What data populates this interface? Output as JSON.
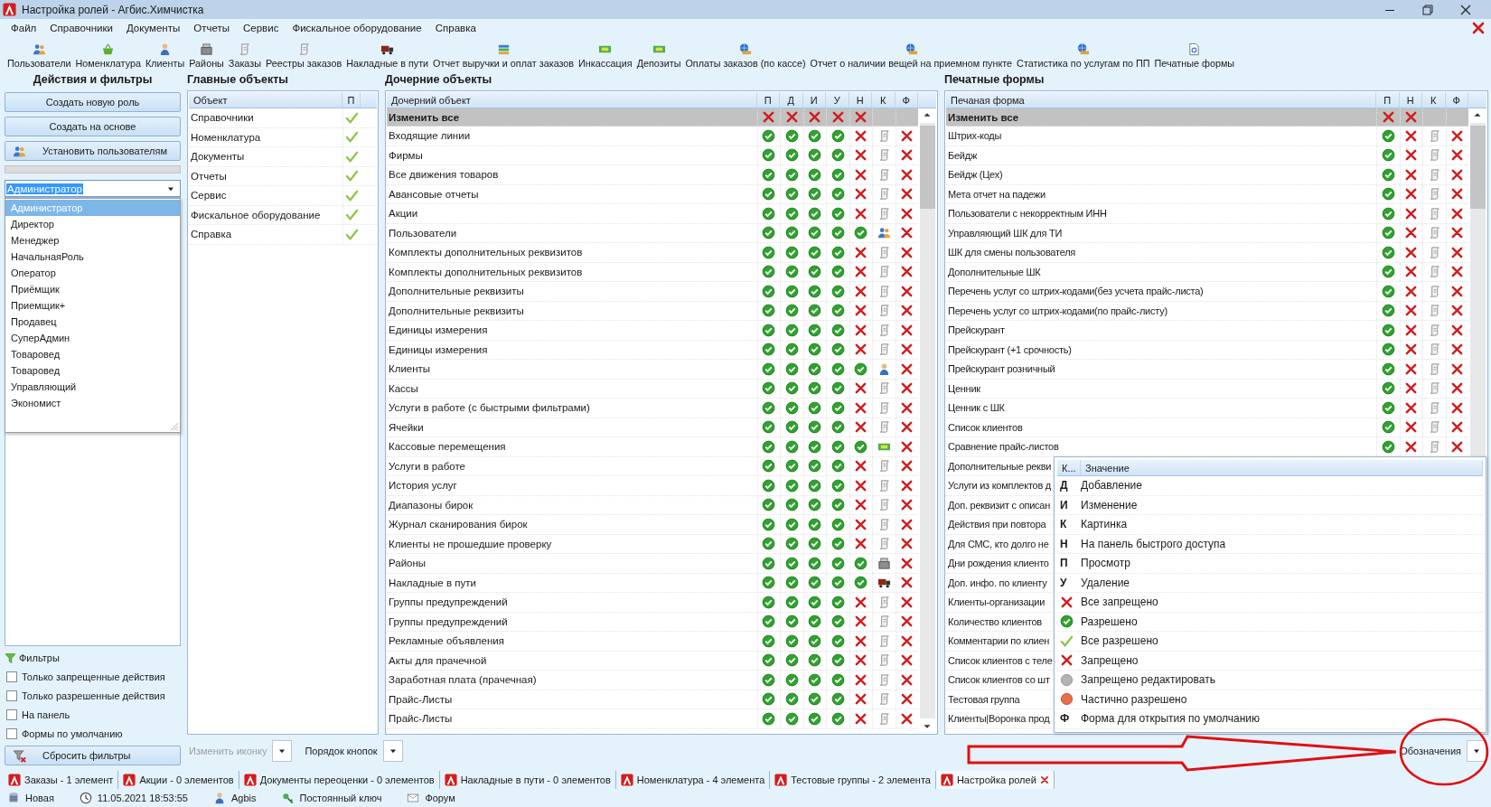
{
  "window": {
    "title": "Настройка ролей - Агбис.Химчистка"
  },
  "menu": [
    "Файл",
    "Справочники",
    "Документы",
    "Отчеты",
    "Сервис",
    "Фискальное оборудование",
    "Справка"
  ],
  "toolbar": [
    "Пользователи",
    "Номенклатура",
    "Клиенты",
    "Районы",
    "Заказы",
    "Реестры заказов",
    "Накладные в пути",
    "Отчет выручки и оплат заказов",
    "Инкассация",
    "Депозиты",
    "Оплаты заказов (по кассе)",
    "Отчет о наличии вещей на приемном пункте",
    "Статистика по услугам по ПП",
    "Печатные формы"
  ],
  "left_panel": {
    "title": "Действия и фильтры",
    "buttons": [
      "Создать новую роль",
      "Создать на основе",
      "Установить пользователям"
    ],
    "role_select": {
      "value": "Администратор",
      "options": [
        {
          "label": "Администратор",
          "selected": true
        },
        {
          "label": "Директор",
          "selected": false
        },
        {
          "label": "Менеджер",
          "selected": false
        },
        {
          "label": "НачальнаяРоль",
          "selected": false
        },
        {
          "label": "Оператор",
          "selected": false
        },
        {
          "label": "Приёмщик",
          "selected": false
        },
        {
          "label": "Приемщик+",
          "selected": false
        },
        {
          "label": "Продавец",
          "selected": false
        },
        {
          "label": "СуперАдмин",
          "selected": false
        },
        {
          "label": "Товаровед",
          "selected": false
        },
        {
          "label": "Товаровед",
          "selected": false
        },
        {
          "label": "Управляющий",
          "selected": false
        },
        {
          "label": "Экономист",
          "selected": false
        }
      ]
    },
    "filters_title": "Фильтры",
    "filters": [
      {
        "label": "Только запрещенные действия",
        "checked": false
      },
      {
        "label": "Только разрешенные действия",
        "checked": false
      },
      {
        "label": "На панель",
        "checked": false
      },
      {
        "label": "Формы по умолчанию",
        "checked": false
      }
    ],
    "reset_button": "Сбросить фильтры"
  },
  "main_objects": {
    "title": "Главные объекты",
    "columns": [
      "Объект",
      "П"
    ],
    "rows": [
      {
        "name": "Справочники",
        "view": true
      },
      {
        "name": "Номенклатура",
        "view": true
      },
      {
        "name": "Документы",
        "view": true
      },
      {
        "name": "Отчеты",
        "view": true
      },
      {
        "name": "Сервис",
        "view": true
      },
      {
        "name": "Фискальное оборудование",
        "view": true
      },
      {
        "name": "Справка",
        "view": true
      }
    ]
  },
  "child_objects": {
    "title": "Дочерние объекты",
    "columns": [
      "Дочерний объект",
      "П",
      "Д",
      "И",
      "У",
      "Н",
      "К",
      "Ф"
    ],
    "change_all": {
      "label": "Изменить все",
      "view": false,
      "add": false,
      "edit": false,
      "delete": false,
      "panel": false
    },
    "rows": [
      {
        "name": "Входящие линии",
        "view": true,
        "add": true,
        "edit": true,
        "delete": true,
        "panel": false,
        "kind": "scroll",
        "default_form": false
      },
      {
        "name": "Фирмы",
        "view": true,
        "add": true,
        "edit": true,
        "delete": true,
        "panel": false,
        "kind": "scroll",
        "default_form": false
      },
      {
        "name": "Все движения товаров",
        "view": true,
        "add": true,
        "edit": true,
        "delete": true,
        "panel": false,
        "kind": "scroll",
        "default_form": false
      },
      {
        "name": "Авансовые отчеты",
        "view": true,
        "add": true,
        "edit": true,
        "delete": true,
        "panel": false,
        "kind": "scroll",
        "default_form": false
      },
      {
        "name": "Акции",
        "view": true,
        "add": true,
        "edit": true,
        "delete": true,
        "panel": false,
        "kind": "scroll",
        "default_form": false
      },
      {
        "name": "Пользователи",
        "view": true,
        "add": true,
        "edit": true,
        "delete": true,
        "panel": true,
        "kind": "users",
        "default_form": false
      },
      {
        "name": "Комплекты дополнительных реквизитов",
        "view": true,
        "add": true,
        "edit": true,
        "delete": true,
        "panel": false,
        "kind": "scroll",
        "default_form": false
      },
      {
        "name": "Комплекты дополнительных реквизитов",
        "view": true,
        "add": true,
        "edit": true,
        "delete": true,
        "panel": false,
        "kind": "scroll",
        "default_form": false
      },
      {
        "name": "Дополнительные реквизиты",
        "view": true,
        "add": true,
        "edit": true,
        "delete": true,
        "panel": false,
        "kind": "scroll",
        "default_form": false
      },
      {
        "name": "Дополнительные реквизиты",
        "view": true,
        "add": true,
        "edit": true,
        "delete": true,
        "panel": false,
        "kind": "scroll",
        "default_form": false
      },
      {
        "name": "Единицы измерения",
        "view": true,
        "add": true,
        "edit": true,
        "delete": true,
        "panel": false,
        "kind": "scroll",
        "default_form": false
      },
      {
        "name": "Единицы измерения",
        "view": true,
        "add": true,
        "edit": true,
        "delete": true,
        "panel": false,
        "kind": "scroll",
        "default_form": false
      },
      {
        "name": "Клиенты",
        "view": true,
        "add": true,
        "edit": true,
        "delete": true,
        "panel": true,
        "kind": "person",
        "default_form": false
      },
      {
        "name": "Кассы",
        "view": true,
        "add": true,
        "edit": true,
        "delete": true,
        "panel": false,
        "kind": "scroll",
        "default_form": false
      },
      {
        "name": "Услуги в работе (с быстрыми фильтрами)",
        "view": true,
        "add": true,
        "edit": true,
        "delete": true,
        "panel": false,
        "kind": "scroll",
        "default_form": false
      },
      {
        "name": "Ячейки",
        "view": true,
        "add": true,
        "edit": true,
        "delete": true,
        "panel": false,
        "kind": "scroll",
        "default_form": false
      },
      {
        "name": "Кассовые перемещения",
        "view": true,
        "add": true,
        "edit": true,
        "delete": true,
        "panel": true,
        "kind": "money",
        "default_form": false
      },
      {
        "name": "Услуги в работе",
        "view": true,
        "add": true,
        "edit": true,
        "delete": true,
        "panel": false,
        "kind": "scroll",
        "default_form": false
      },
      {
        "name": "История услуг",
        "view": true,
        "add": true,
        "edit": true,
        "delete": true,
        "panel": false,
        "kind": "scroll",
        "default_form": false
      },
      {
        "name": "Диапазоны бирок",
        "view": true,
        "add": true,
        "edit": true,
        "delete": true,
        "panel": false,
        "kind": "scroll",
        "default_form": false
      },
      {
        "name": "Журнал сканирования бирок",
        "view": true,
        "add": true,
        "edit": true,
        "delete": true,
        "panel": false,
        "kind": "scroll",
        "default_form": false
      },
      {
        "name": "Клиенты не прошедшие проверку",
        "view": true,
        "add": true,
        "edit": true,
        "delete": true,
        "panel": false,
        "kind": "scroll",
        "default_form": false
      },
      {
        "name": "Районы",
        "view": true,
        "add": true,
        "edit": true,
        "delete": true,
        "panel": true,
        "kind": "register",
        "default_form": false
      },
      {
        "name": "Накладные в пути",
        "view": true,
        "add": true,
        "edit": true,
        "delete": true,
        "panel": true,
        "kind": "truck",
        "default_form": false
      },
      {
        "name": "Группы предупреждений",
        "view": true,
        "add": true,
        "edit": true,
        "delete": true,
        "panel": false,
        "kind": "scroll",
        "default_form": false
      },
      {
        "name": "Группы предупреждений",
        "view": true,
        "add": true,
        "edit": true,
        "delete": true,
        "panel": false,
        "kind": "scroll",
        "default_form": false
      },
      {
        "name": "Рекламные объявления",
        "view": true,
        "add": true,
        "edit": true,
        "delete": true,
        "panel": false,
        "kind": "scroll",
        "default_form": false
      },
      {
        "name": "Акты для прачечной",
        "view": true,
        "add": true,
        "edit": true,
        "delete": true,
        "panel": false,
        "kind": "scroll",
        "default_form": false
      },
      {
        "name": "Заработная плата (прачечная)",
        "view": true,
        "add": true,
        "edit": true,
        "delete": true,
        "panel": false,
        "kind": "scroll",
        "default_form": false
      },
      {
        "name": "Прайс-Листы",
        "view": true,
        "add": true,
        "edit": true,
        "delete": true,
        "panel": false,
        "kind": "scroll",
        "default_form": false
      },
      {
        "name": "Прайс-Листы",
        "view": true,
        "add": true,
        "edit": true,
        "delete": true,
        "panel": false,
        "kind": "scroll",
        "default_form": false
      }
    ]
  },
  "print_forms": {
    "title": "Печатные формы",
    "columns": [
      "Печаная форма",
      "П",
      "Н",
      "К",
      "Ф"
    ],
    "change_all": {
      "label": "Изменить все",
      "view": false,
      "panel": false
    },
    "rows": [
      {
        "name": "Штрих-коды",
        "view": true,
        "panel": false,
        "kind": "scroll",
        "default_form": false
      },
      {
        "name": "Бейдж",
        "view": true,
        "panel": false,
        "kind": "scroll",
        "default_form": false
      },
      {
        "name": "Бейдж (Цех)",
        "view": true,
        "panel": false,
        "kind": "scroll",
        "default_form": false
      },
      {
        "name": "Мета отчет на падежи",
        "view": true,
        "panel": false,
        "kind": "scroll",
        "default_form": false
      },
      {
        "name": "Пользователи с некорректным ИНН",
        "view": true,
        "panel": false,
        "kind": "scroll",
        "default_form": false
      },
      {
        "name": "Управляющий ШК для ТИ",
        "view": true,
        "panel": false,
        "kind": "scroll",
        "default_form": false
      },
      {
        "name": "ШК для смены пользователя",
        "view": true,
        "panel": false,
        "kind": "scroll",
        "default_form": false
      },
      {
        "name": "Дополнительные ШК",
        "view": true,
        "panel": false,
        "kind": "scroll",
        "default_form": false
      },
      {
        "name": "Перечень услуг со штрих-кодами(без усчета прайс-листа)",
        "view": true,
        "panel": false,
        "kind": "scroll",
        "default_form": false
      },
      {
        "name": "Перечень услуг со штрих-кодами(по прайс-листу)",
        "view": true,
        "panel": false,
        "kind": "scroll",
        "default_form": false
      },
      {
        "name": "Прейскурант",
        "view": true,
        "panel": false,
        "kind": "scroll",
        "default_form": false
      },
      {
        "name": "Прейскурант (+1 срочность)",
        "view": true,
        "panel": false,
        "kind": "scroll",
        "default_form": false
      },
      {
        "name": "Прейскурант розничный",
        "view": true,
        "panel": false,
        "kind": "scroll",
        "default_form": false
      },
      {
        "name": "Ценник",
        "view": true,
        "panel": false,
        "kind": "scroll",
        "default_form": false
      },
      {
        "name": "Ценник с ШК",
        "view": true,
        "panel": false,
        "kind": "scroll",
        "default_form": false
      },
      {
        "name": "Список клиентов",
        "view": true,
        "panel": false,
        "kind": "scroll",
        "default_form": false
      },
      {
        "name": "Сравнение прайс-листов",
        "view": true,
        "panel": false,
        "kind": "scroll",
        "default_form": false
      },
      {
        "name": "Дополнительные рекви"
      },
      {
        "name": "Услуги из комплектов д"
      },
      {
        "name": "Доп. реквизит с описан"
      },
      {
        "name": "Действия при повтора"
      },
      {
        "name": "Для СМС, кто долго не"
      },
      {
        "name": "Дни рождения клиенто"
      },
      {
        "name": "Доп. инфо. по клиенту"
      },
      {
        "name": "Клиенты-организации"
      },
      {
        "name": "Количество клиентов"
      },
      {
        "name": "Комментарии по клиен"
      },
      {
        "name": "Список клиентов с теле"
      },
      {
        "name": "Список клиентов со шт"
      },
      {
        "name": "Тестовая группа"
      },
      {
        "name": "Клиенты|Воронка прод"
      }
    ]
  },
  "legend": {
    "columns": [
      "К...",
      "Значение"
    ],
    "rows": [
      {
        "kind": "letter",
        "key": "Д",
        "value": "Добавление"
      },
      {
        "kind": "letter",
        "key": "И",
        "value": "Изменение"
      },
      {
        "kind": "letter",
        "key": "К",
        "value": "Картинка"
      },
      {
        "kind": "letter",
        "key": "Н",
        "value": "На панель быстрого доступа"
      },
      {
        "kind": "letter",
        "key": "П",
        "value": "Просмотр"
      },
      {
        "kind": "letter",
        "key": "У",
        "value": "Удаление"
      },
      {
        "kind": "cross",
        "value": "Все запрещено"
      },
      {
        "kind": "checkcircle",
        "value": "Разрешено"
      },
      {
        "kind": "check",
        "value": "Все разрешено"
      },
      {
        "kind": "cross",
        "value": "Запрещено"
      },
      {
        "kind": "locked",
        "value": "Запрещено редактировать"
      },
      {
        "kind": "partial",
        "value": "Частично разрешено"
      },
      {
        "kind": "letter",
        "key": "Ф",
        "value": "Форма для открытия по умолчанию"
      }
    ]
  },
  "bottom_bar": {
    "left": [
      {
        "label": "Изменить иконку",
        "disabled": true
      },
      {
        "label": "Порядок кнопок",
        "disabled": false
      }
    ],
    "right": {
      "label": "Обозначения",
      "disabled": false
    }
  },
  "tabs": [
    {
      "label": "Заказы - 1 элемент",
      "selected": false,
      "closable": false
    },
    {
      "label": "Акции - 0 элементов",
      "selected": false,
      "closable": false
    },
    {
      "label": "Документы переоценки - 0 элементов",
      "selected": false,
      "closable": false
    },
    {
      "label": "Накладные в пути - 0 элементов",
      "selected": false,
      "closable": false
    },
    {
      "label": "Номенклатура - 4 элемента",
      "selected": false,
      "closable": false
    },
    {
      "label": "Тестовые группы - 2 элемента",
      "selected": false,
      "closable": false
    },
    {
      "label": "Настройка ролей",
      "selected": true,
      "closable": true
    }
  ],
  "status_bar": [
    "Новая",
    "11.05.2021 18:53:55",
    "Agbis",
    "Постоянный ключ",
    "Форум"
  ]
}
